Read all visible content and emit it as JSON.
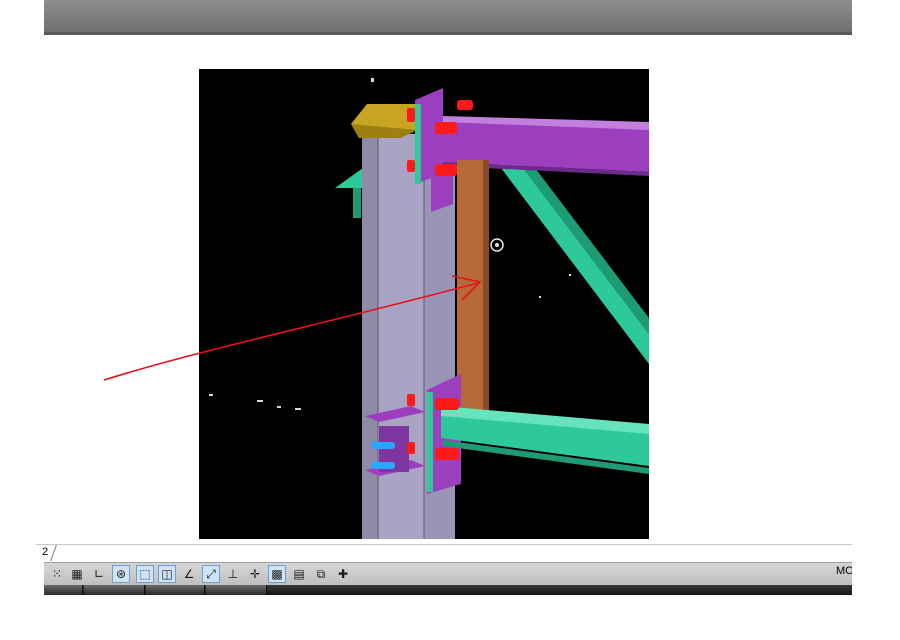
{
  "layout_tab": {
    "label": "2"
  },
  "status_bar": {
    "items": [
      {
        "name": "snap-mode",
        "icon": "snap-grid-icon",
        "glyph": "⁙"
      },
      {
        "name": "grid-display",
        "icon": "grid-icon",
        "glyph": "▦"
      },
      {
        "name": "ortho-mode",
        "icon": "ortho-icon",
        "glyph": "∟"
      },
      {
        "name": "polar-tracking",
        "icon": "polar-icon",
        "glyph": "⊛",
        "active": true
      },
      {
        "name": "object-snap",
        "icon": "osnap-icon",
        "glyph": "⬚",
        "active": true
      },
      {
        "name": "3d-object-snap",
        "icon": "3d-osnap-icon",
        "glyph": "◫",
        "active": true
      },
      {
        "name": "object-snap-tracking",
        "icon": "otrack-icon",
        "glyph": "∠"
      },
      {
        "name": "dynamic-ucs",
        "icon": "ducs-icon",
        "glyph": "⤢",
        "active": true
      },
      {
        "name": "dynamic-input",
        "icon": "dyn-icon",
        "glyph": "⊥"
      },
      {
        "name": "lineweight",
        "icon": "lineweight-icon",
        "glyph": "✛"
      },
      {
        "name": "transparency",
        "icon": "transparency-icon",
        "glyph": "▩",
        "active": true
      },
      {
        "name": "quick-properties",
        "icon": "quick-props-icon",
        "glyph": "▤"
      },
      {
        "name": "selection-cycling",
        "icon": "sel-cycle-icon",
        "glyph": "⧉"
      },
      {
        "name": "annotation-monitor",
        "icon": "plus-icon",
        "glyph": "✚"
      }
    ],
    "model_label": "MODEL"
  },
  "colors": {
    "viewport_bg": "#000000",
    "column_steel": "#a9a3c4",
    "beam_purple": "#9b3fbf",
    "brace_green": "#2ec99a",
    "post_brown": "#b8693a",
    "cap_plate_yellow": "#c8a521",
    "bolt_red": "#ff1a1a",
    "bolt_blue": "#2aa7ff",
    "annotation_red": "#e0141c"
  }
}
